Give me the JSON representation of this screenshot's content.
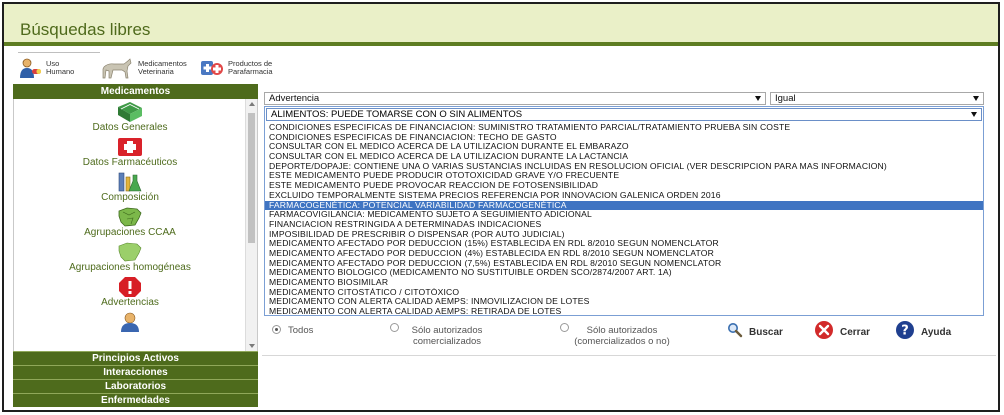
{
  "header": {
    "title": "Búsquedas libres"
  },
  "quicklinks": [
    {
      "label": "Uso\nHumano",
      "icon": "person-pill-icon"
    },
    {
      "label": "Medicamentos\nVeterinaria",
      "icon": "horse-icon"
    },
    {
      "label": "Productos de\nParafarmacia",
      "icon": "parafarmacia-icon"
    }
  ],
  "sidebar": {
    "header": "Medicamentos",
    "items": [
      {
        "label": "Datos Generales",
        "icon": "book-icon"
      },
      {
        "label": "Datos Farmacéuticos",
        "icon": "first-aid-icon"
      },
      {
        "label": "Composición",
        "icon": "lab-flask-icon"
      },
      {
        "label": "Agrupaciones CCAA",
        "icon": "spain-map-icon"
      },
      {
        "label": "Agrupaciones homogéneas",
        "icon": "spain-map-green-icon"
      },
      {
        "label": "Advertencias",
        "icon": "warning-icon"
      }
    ],
    "sections": [
      "Principios Activos",
      "Interacciones",
      "Laboratorios",
      "Enfermedades"
    ]
  },
  "filter": {
    "field_select": "Advertencia",
    "operator_select": "Igual",
    "value_current": "ALIMENTOS: PUEDE TOMARSE CON O SIN ALIMENTOS",
    "selected_index": 8,
    "options": [
      "CONDICIONES ESPECIFICAS DE FINANCIACION: SUMINISTRO TRATAMIENTO PARCIAL/TRATAMIENTO PRUEBA SIN COSTE",
      "CONDICIONES ESPECIFICAS DE FINANCIACION: TECHO DE GASTO",
      "CONSULTAR CON EL MEDICO ACERCA DE LA UTILIZACION DURANTE EL EMBARAZO",
      "CONSULTAR CON EL MEDICO ACERCA DE LA UTILIZACION DURANTE LA LACTANCIA",
      "DEPORTE/DOPAJE: CONTIENE UNA O VARIAS SUSTANCIAS INCLUIDAS EN RESOLUCION OFICIAL (VER DESCRIPCION PARA MAS INFORMACION)",
      "ESTE MEDICAMENTO PUEDE PRODUCIR OTOTOXICIDAD GRAVE Y/O FRECUENTE",
      "ESTE MEDICAMENTO PUEDE PROVOCAR REACCION DE FOTOSENSIBILIDAD",
      "EXCLUIDO TEMPORALMENTE SISTEMA PRECIOS REFERENCIA POR INNOVACION GALENICA ORDEN 2016",
      "FARMACOGENÉTICA: POTENCIAL VARIABILIDAD FARMACOGENÉTICA",
      "FARMACOVIGILANCIA: MEDICAMENTO SUJETO A SEGUIMIENTO ADICIONAL",
      "FINANCIACION RESTRINGIDA A DETERMINADAS INDICACIONES",
      "IMPOSIBILIDAD DE PRESCRIBIR O DISPENSAR (POR AUTO JUDICIAL)",
      "MEDICAMENTO AFECTADO POR DEDUCCION (15%) ESTABLECIDA EN RDL 8/2010 SEGUN NOMENCLATOR",
      "MEDICAMENTO AFECTADO POR DEDUCCION (4%) ESTABLECIDA EN RDL 8/2010 SEGUN NOMENCLATOR",
      "MEDICAMENTO AFECTADO POR DEDUCCION (7,5%) ESTABLECIDA EN RDL 8/2010 SEGUN NOMENCLATOR",
      "MEDICAMENTO BIOLOGICO (MEDICAMENTO NO SUSTITUIBLE ORDEN SCO/2874/2007 ART. 1A)",
      "MEDICAMENTO BIOSIMILAR",
      "MEDICAMENTO CITOSTÁTICO / CITOTÓXICO",
      "MEDICAMENTO CON ALERTA CALIDAD AEMPS: INMOVILIZACION DE LOTES",
      "MEDICAMENTO CON ALERTA CALIDAD AEMPS: RETIRADA DE LOTES"
    ]
  },
  "radios": {
    "todos": "Todos",
    "solo_comercializados": "Sólo autorizados\ncomercializados",
    "solo_comercializados_o_no": "Sólo autorizados\n(comercializados o no)"
  },
  "actions": {
    "buscar": "Buscar",
    "cerrar": "Cerrar",
    "ayuda": "Ayuda"
  },
  "colors": {
    "brand_green": "#4e6b1c",
    "header_bg": "#eaf0c8",
    "selected_blue": "#3f74c2"
  }
}
